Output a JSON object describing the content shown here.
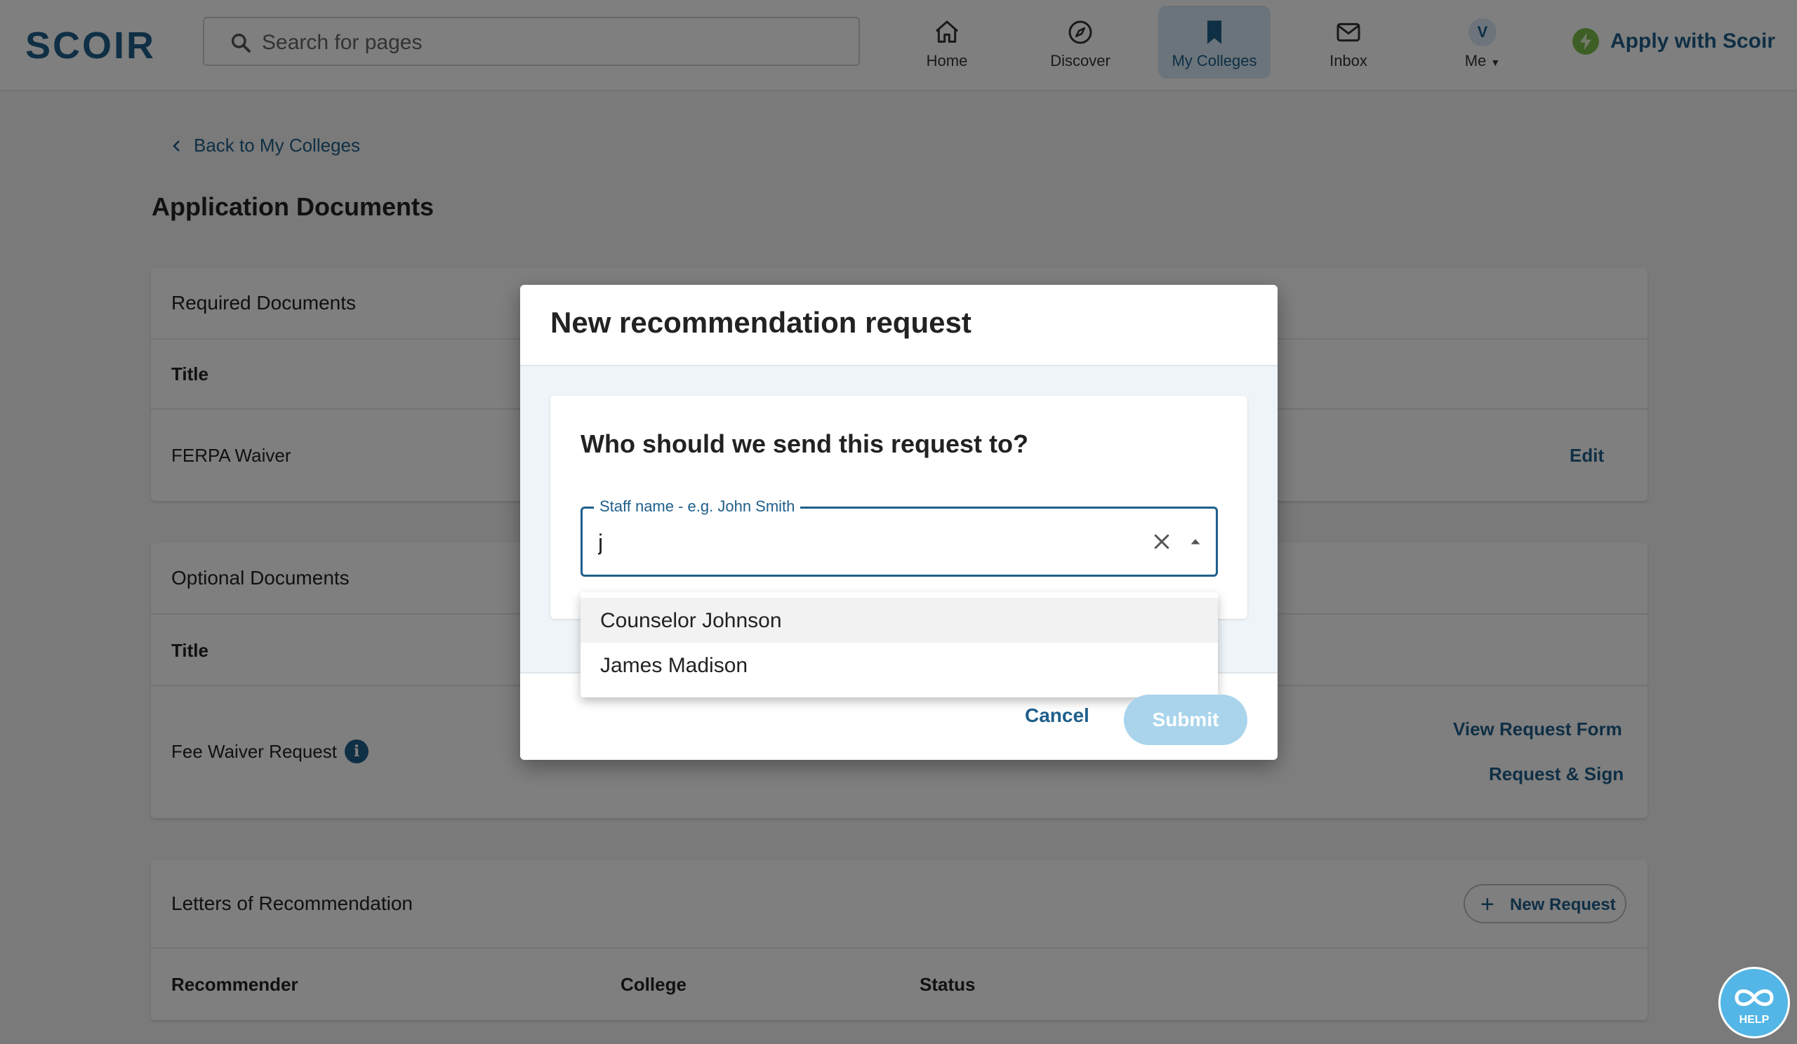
{
  "header": {
    "logo": "SCOIR",
    "search_placeholder": "Search for pages",
    "nav": [
      {
        "label": "Home",
        "icon": "home-icon"
      },
      {
        "label": "Discover",
        "icon": "compass-icon"
      },
      {
        "label": "My Colleges",
        "icon": "bookmark-icon",
        "active": true
      },
      {
        "label": "Inbox",
        "icon": "mail-icon"
      },
      {
        "label": "Me",
        "icon": "avatar",
        "avatar_initial": "V"
      }
    ],
    "apply_label": "Apply with Scoir"
  },
  "page": {
    "back_label": "Back to My Colleges",
    "title": "Application Documents",
    "required": {
      "title": "Required Documents",
      "col_title": "Title",
      "rows": [
        {
          "title": "FERPA Waiver",
          "action": "Edit"
        }
      ]
    },
    "optional": {
      "title": "Optional Documents",
      "col_title": "Title",
      "rows": [
        {
          "title": "Fee Waiver Request",
          "actions": [
            "View Request Form",
            "Request & Sign"
          ]
        }
      ]
    },
    "letters": {
      "title": "Letters of Recommendation",
      "new_request_label": "New Request",
      "columns": [
        "Recommender",
        "College",
        "Status"
      ]
    }
  },
  "help_label": "HELP",
  "modal": {
    "title": "New recommendation request",
    "question": "Who should we send this request to?",
    "field_label": "Staff name - e.g. John Smith",
    "field_value": "j",
    "options": [
      "Counselor Johnson",
      "James Madison"
    ],
    "cancel_label": "Cancel",
    "submit_label": "Submit"
  },
  "colors": {
    "brand": "#1f5f8b",
    "active_nav_bg": "#d5e8f5",
    "submit_disabled": "#a9d4ec",
    "apply_icon": "#7bbf4a",
    "help_button": "#53b6e6"
  }
}
